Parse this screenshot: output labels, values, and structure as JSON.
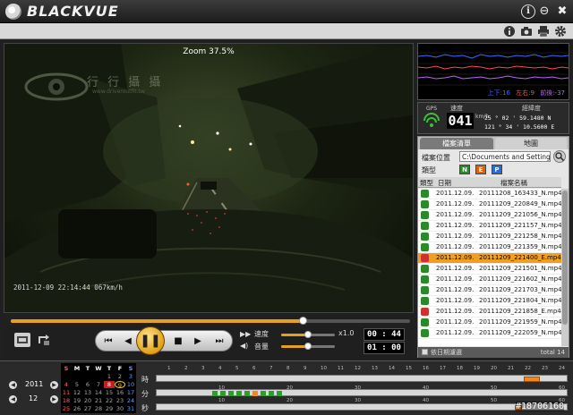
{
  "app": {
    "title": "BLACKVUE",
    "info_symbol": "i",
    "minimize_symbol": "⊖",
    "close_symbol": "✖"
  },
  "toolbar": {
    "icons": [
      "info-icon",
      "camera-icon",
      "print-icon",
      "settings-icon"
    ]
  },
  "video": {
    "zoom_label": "Zoom 37.5%",
    "timestamp_overlay": "2011-12-09 22:14:44    067km/h",
    "watermark_title": "行 行 攝 攝",
    "watermark_sub": "www.driveroutfit.tw"
  },
  "playback": {
    "progress": 0.73,
    "buttons": {
      "first": "⏮",
      "prev": "◀",
      "play_pause": "❚❚",
      "stop": "■",
      "next": "▶",
      "last": "⏭"
    },
    "speed_label": "速度",
    "speed_value": "x1.0",
    "volume_label": "音量",
    "speed_slider": 0.5,
    "volume_slider": 0.5,
    "current_time": "00 : 44",
    "total_time": "01 : 00"
  },
  "gsensor": {
    "legend": [
      "上下:16",
      "左右:9",
      "前後:-37"
    ],
    "legend_colors": [
      "#3b6bff",
      "#ff4a4a",
      "#c060ff"
    ]
  },
  "gps": {
    "signal_label": "GPS",
    "speed_label": "速度",
    "speed_value": "041",
    "speed_unit": "km/h",
    "coord_label": "經緯度",
    "latitude": "25 ° 02 ' 59.1480 N",
    "longitude": "121 ° 34 ' 10.5600 E"
  },
  "file_panel": {
    "tabs": [
      "檔案清單",
      "地圖"
    ],
    "folder_label": "檔案位置",
    "folder_path": "C:\\Documents and Settings",
    "type_label": "類型",
    "type_buttons": [
      "N",
      "E",
      "P"
    ],
    "type_colors": [
      "#2a8a2a",
      "#e06010",
      "#2a6ae0"
    ],
    "columns": [
      "類型",
      "日期",
      "檔案名稱"
    ],
    "rows": [
      {
        "date": "2011.12.09.",
        "name": "20111208_163433_N.mp4",
        "kind": "N"
      },
      {
        "date": "2011.12.09.",
        "name": "20111209_220849_N.mp4",
        "kind": "N"
      },
      {
        "date": "2011.12.09.",
        "name": "20111209_221056_N.mp4",
        "kind": "N"
      },
      {
        "date": "2011.12.09.",
        "name": "20111209_221157_N.mp4",
        "kind": "N"
      },
      {
        "date": "2011.12.09.",
        "name": "20111209_221258_N.mp4",
        "kind": "N"
      },
      {
        "date": "2011.12.09.",
        "name": "20111209_221359_N.mp4",
        "kind": "N"
      },
      {
        "date": "2011.12.09.",
        "name": "20111209_221400_E.mp4",
        "kind": "E",
        "selected": true
      },
      {
        "date": "2011.12.09.",
        "name": "20111209_221501_N.mp4",
        "kind": "N"
      },
      {
        "date": "2011.12.09.",
        "name": "20111209_221602_N.mp4",
        "kind": "N"
      },
      {
        "date": "2011.12.09.",
        "name": "20111209_221703_N.mp4",
        "kind": "N"
      },
      {
        "date": "2011.12.09.",
        "name": "20111209_221804_N.mp4",
        "kind": "N"
      },
      {
        "date": "2011.12.09.",
        "name": "20111209_221858_E.mp4",
        "kind": "E"
      },
      {
        "date": "2011.12.09.",
        "name": "20111209_221959_N.mp4",
        "kind": "N"
      },
      {
        "date": "2011.12.09.",
        "name": "20111209_222059_N.mp4",
        "kind": "N"
      }
    ],
    "footer_checkbox_label": "依日期濾選",
    "footer_total": "total 14"
  },
  "bottom": {
    "year": "2011",
    "month": "12",
    "weekdays": [
      "S",
      "M",
      "T",
      "W",
      "T",
      "F",
      "S"
    ],
    "calendar_rows": [
      [
        "",
        "",
        "",
        "",
        "1",
        "2",
        "3"
      ],
      [
        "4",
        "5",
        "6",
        "7",
        "8",
        "9",
        "10"
      ],
      [
        "11",
        "12",
        "13",
        "14",
        "15",
        "16",
        "17"
      ],
      [
        "18",
        "19",
        "20",
        "21",
        "22",
        "23",
        "24"
      ],
      [
        "25",
        "26",
        "27",
        "28",
        "29",
        "30",
        "31"
      ]
    ],
    "selected_day": "9",
    "highlight_day": "8",
    "hour_label": "時",
    "minute_label": "分",
    "second_label": "秒",
    "hour_ticks": [
      "1",
      "2",
      "3",
      "4",
      "5",
      "6",
      "7",
      "8",
      "9",
      "10",
      "11",
      "12",
      "13",
      "14",
      "15",
      "16",
      "17",
      "18",
      "19",
      "20",
      "21",
      "22",
      "23",
      "24"
    ],
    "minute_ticks": [
      "10",
      "20",
      "30",
      "40",
      "50",
      "60"
    ],
    "second_ticks": [
      "10",
      "20",
      "30",
      "40",
      "50",
      "60"
    ]
  },
  "watermark_id": "#18706160"
}
